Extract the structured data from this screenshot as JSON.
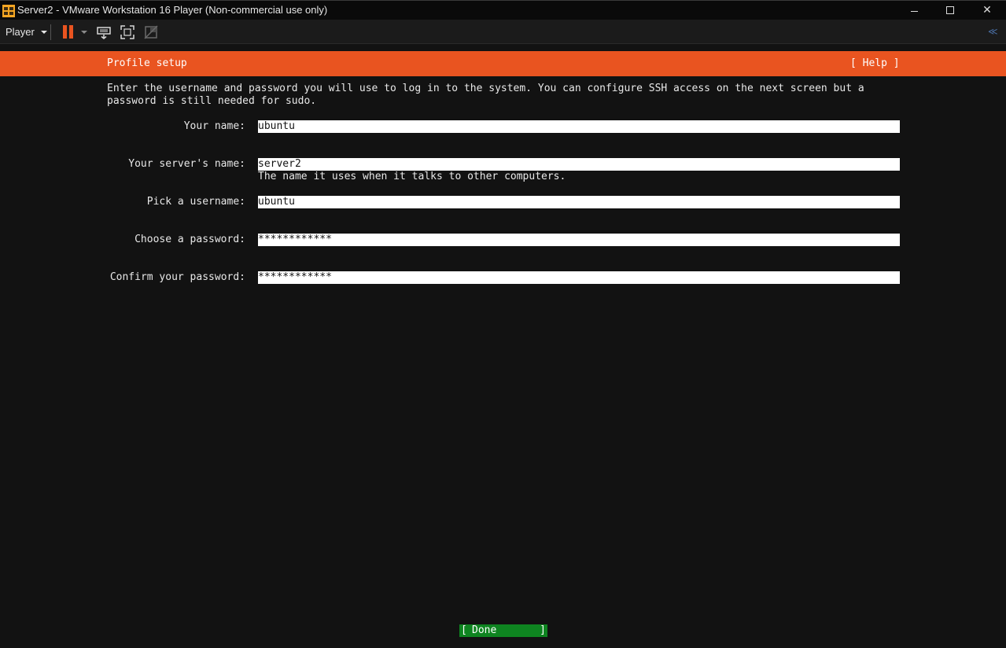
{
  "window": {
    "title": "Server2 - VMware Workstation 16 Player (Non-commercial use only)",
    "controls": {
      "minimize": "–",
      "maximize": "□",
      "close": "✕"
    }
  },
  "toolbar": {
    "player_menu": "Player",
    "icons": [
      "pause-icon",
      "send-ctrl-alt-del-icon",
      "fullscreen-icon",
      "unity-icon",
      "collapse-toolbar-icon"
    ]
  },
  "installer": {
    "header_title": "Profile setup",
    "help": "[ Help ]",
    "intro": "Enter the username and password you will use to log in to the system. You can configure SSH access on the next screen but a\npassword is still needed for sudo.",
    "fields": [
      {
        "label": "Your name:",
        "value": "ubuntu",
        "help": ""
      },
      {
        "label": "Your server's name:",
        "value": "server2",
        "help": "The name it uses when it talks to other computers."
      },
      {
        "label": "Pick a username:",
        "value": "ubuntu",
        "help": ""
      },
      {
        "label": "Choose a password:",
        "value": "************",
        "help": ""
      },
      {
        "label": "Confirm your password:",
        "value": "************",
        "help": ""
      }
    ],
    "done": {
      "left_bracket": "[",
      "label": "Done",
      "right_bracket": "]"
    }
  },
  "colors": {
    "accent_orange": "#e95420",
    "done_green": "#0e8420",
    "background": "#121212"
  }
}
